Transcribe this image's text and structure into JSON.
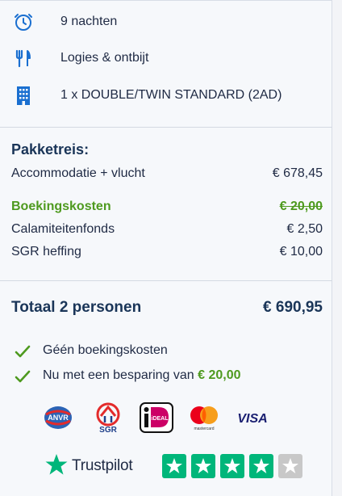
{
  "features": [
    {
      "icon": "clock-icon",
      "label": "9 nachten"
    },
    {
      "icon": "cutlery-icon",
      "label": "Logies & ontbijt"
    },
    {
      "icon": "building-icon",
      "label": "1 x DOUBLE/TWIN STANDARD (2AD)"
    }
  ],
  "summary": {
    "title": "Pakketreis:",
    "rows": [
      {
        "label": "Accommodatie + vlucht",
        "value": "€ 678,45"
      },
      {
        "label": "Boekingskosten",
        "value": "€ 20,00"
      },
      {
        "label": "Calamiteitenfonds",
        "value": "€ 2,50"
      },
      {
        "label": "SGR heffing",
        "value": "€ 10,00"
      }
    ]
  },
  "total": {
    "label": "Totaal 2 personen",
    "value": "€ 690,95"
  },
  "benefits": [
    {
      "text": "Géén boekingskosten",
      "amount": ""
    },
    {
      "text": "Nu met een besparing van ",
      "amount": "€ 20,00"
    }
  ],
  "logos": {
    "anvr": "ANVR",
    "sgr": "SGR",
    "ideal": "iDEAL",
    "mastercard": "mastercard",
    "visa": "VISA"
  },
  "trustpilot": {
    "label": "Trustpilot",
    "stars": 4,
    "max_stars": 5,
    "star_color": "#00b67a",
    "empty_color": "#c8c8c8"
  },
  "colors": {
    "accent_blue": "#1a6fd0",
    "green": "#4e9a1f",
    "navy": "#1a3558"
  }
}
